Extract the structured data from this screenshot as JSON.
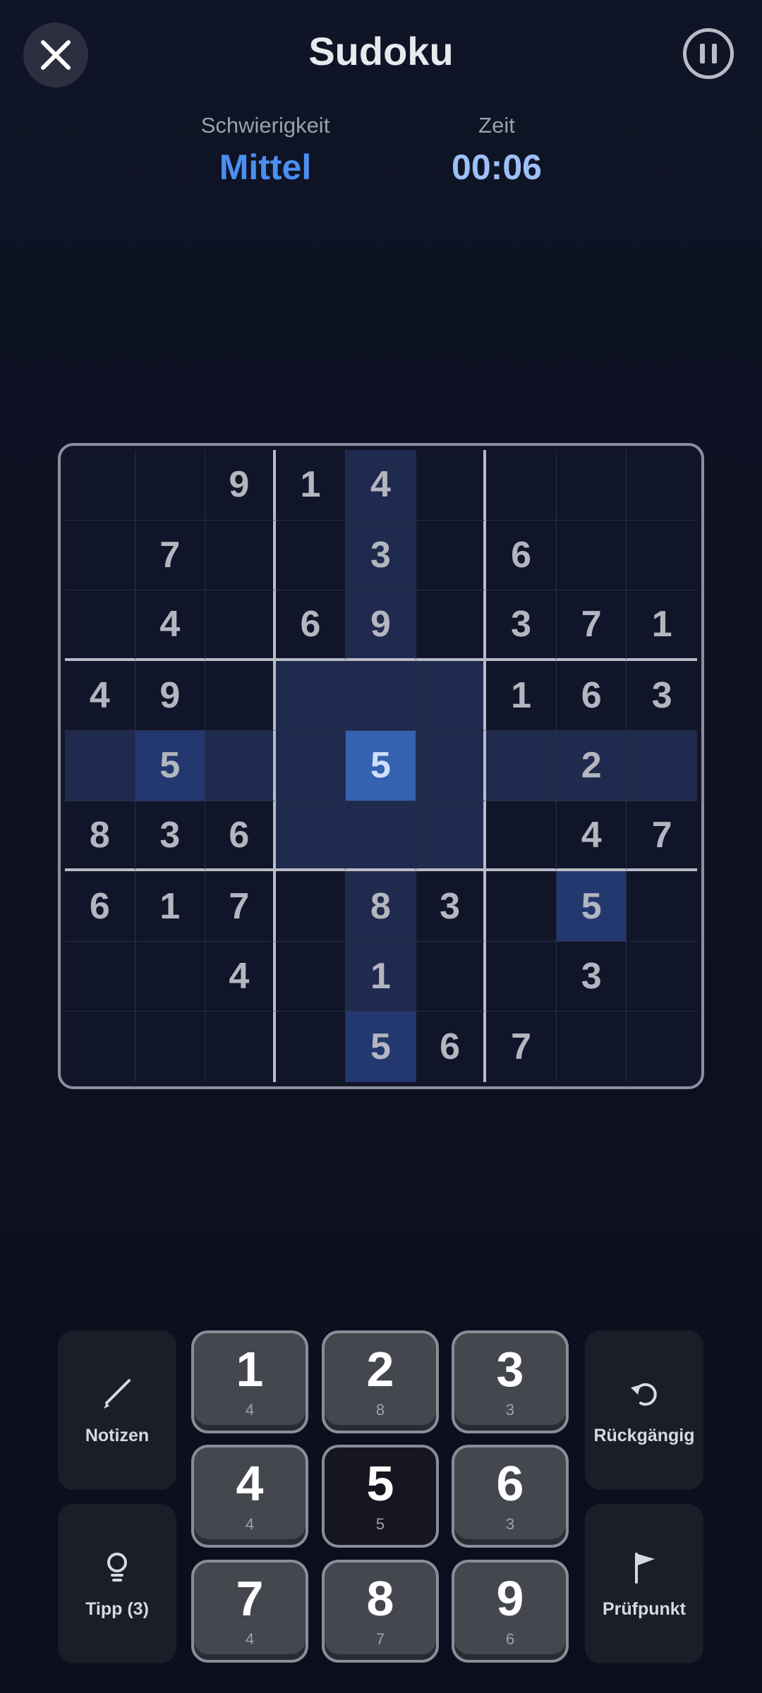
{
  "header": {
    "title": "Sudoku",
    "difficulty_label": "Schwierigkeit",
    "difficulty_value": "Mittel",
    "time_label": "Zeit",
    "time_value": "00:06"
  },
  "board": {
    "rows": [
      [
        "",
        "",
        "9",
        "1",
        "4",
        "",
        "",
        "",
        ""
      ],
      [
        "",
        "7",
        "",
        "",
        "3",
        "",
        "6",
        "",
        ""
      ],
      [
        "",
        "4",
        "",
        "6",
        "9",
        "",
        "3",
        "7",
        "1"
      ],
      [
        "4",
        "9",
        "",
        "",
        "",
        "",
        "1",
        "6",
        "3"
      ],
      [
        "",
        "5",
        "",
        "",
        "5",
        "",
        "",
        "2",
        ""
      ],
      [
        "8",
        "3",
        "6",
        "",
        "",
        "",
        "",
        "4",
        "7"
      ],
      [
        "6",
        "1",
        "7",
        "",
        "8",
        "3",
        "",
        "5",
        ""
      ],
      [
        "",
        "",
        "4",
        "",
        "1",
        "",
        "",
        "3",
        ""
      ],
      [
        "",
        "",
        "",
        "",
        "5",
        "6",
        "7",
        "",
        ""
      ]
    ],
    "selected_cell": [
      4,
      4
    ],
    "selected_value": "5"
  },
  "controls": {
    "notes_label": "Notizen",
    "hint_label": "Tipp (3)",
    "undo_label": "Rückgängig",
    "checkpoint_label": "Prüfpunkt"
  },
  "numpad": [
    {
      "n": "1",
      "count": "4"
    },
    {
      "n": "2",
      "count": "8"
    },
    {
      "n": "3",
      "count": "3"
    },
    {
      "n": "4",
      "count": "4"
    },
    {
      "n": "5",
      "count": "5"
    },
    {
      "n": "6",
      "count": "3"
    },
    {
      "n": "7",
      "count": "4"
    },
    {
      "n": "8",
      "count": "7"
    },
    {
      "n": "9",
      "count": "6"
    }
  ],
  "colors": {
    "accent": "#4b8ff0",
    "selected_cell": "#3562b0",
    "highlight": "#1f2a4e",
    "same_number": "#22386e"
  }
}
